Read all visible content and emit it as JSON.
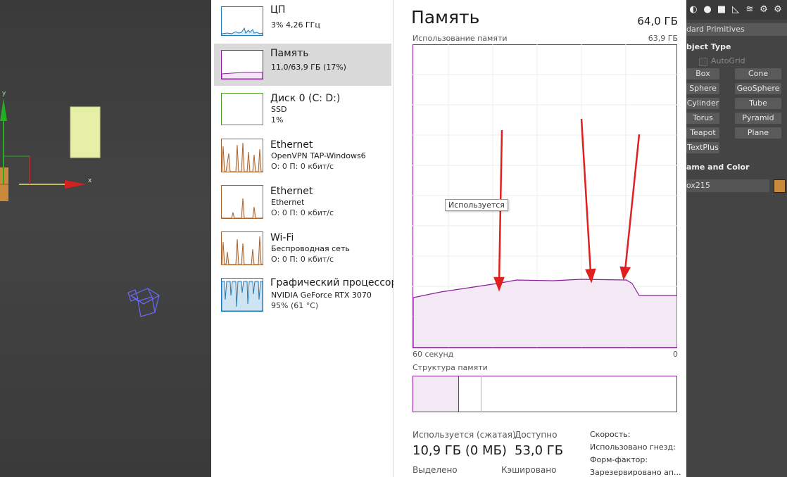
{
  "viewport": {
    "axis_x_label": "x",
    "axis_y_label": "y",
    "colors": {
      "bg": "#3a3a3a",
      "box": "#e5efa6",
      "red_axis": "#d62020",
      "green_axis": "#22b022"
    }
  },
  "task_manager": {
    "sidebar": {
      "items": [
        {
          "title": "ЦП",
          "lines": [
            "3% 4,26 ГГц"
          ],
          "color": "#1f7ab8",
          "selected": false
        },
        {
          "title": "Память",
          "lines": [
            "11,0/63,9 ГБ (17%)"
          ],
          "color": "#8b1f9b",
          "selected": true
        },
        {
          "title": "Диск 0 (C: D:)",
          "lines": [
            "SSD",
            "1%"
          ],
          "color": "#4aa02c",
          "selected": false
        },
        {
          "title": "Ethernet",
          "lines": [
            "OpenVPN TAP-Windows6",
            "О: 0 П: 0 кбит/с"
          ],
          "color": "#a7602a",
          "selected": false
        },
        {
          "title": "Ethernet",
          "lines": [
            "Ethernet",
            "О: 0 П: 0 кбит/с"
          ],
          "color": "#a7602a",
          "selected": false
        },
        {
          "title": "Wi-Fi",
          "lines": [
            "Беспроводная сеть",
            "О: 0 П: 0 кбит/с"
          ],
          "color": "#a7602a",
          "selected": false
        },
        {
          "title": "Графический процессор",
          "lines": [
            "NVIDIA GeForce RTX 3070",
            "95% (61 °C)"
          ],
          "color": "#1f7ab8",
          "selected": false
        }
      ]
    },
    "main": {
      "title": "Память",
      "total": "64,0 ГБ",
      "graph_label": "Использование памяти",
      "graph_max": "63,9 ГБ",
      "time_left": "60 секунд",
      "time_right": "0",
      "tooltip": "Используется",
      "composition_label": "Структура памяти",
      "stats": {
        "in_use_label": "Используется (сжатая)",
        "in_use_value": "10,9 ГБ (0 МБ)",
        "available_label": "Доступно",
        "available_value": "53,0 ГБ",
        "committed_label": "Выделено",
        "cached_label": "Кэшировано"
      },
      "right_labels": [
        "Скорость:",
        "Использовано гнезд:",
        "Форм-фактор:",
        "Зарезервировано ап..."
      ],
      "accent_color": "#8b1f9b"
    }
  },
  "command_panel": {
    "category": "dard Primitives",
    "object_type_header": "bject Type",
    "autogrid_label": "AutoGrid",
    "buttons": [
      "Box",
      "Cone",
      "Sphere",
      "GeoSphere",
      "Cylinder",
      "Tube",
      "Torus",
      "Pyramid",
      "Teapot",
      "Plane",
      "TextPlus"
    ],
    "name_color_header": "ame and Color",
    "object_name": "ox215",
    "object_color": "#c98a3c"
  }
}
